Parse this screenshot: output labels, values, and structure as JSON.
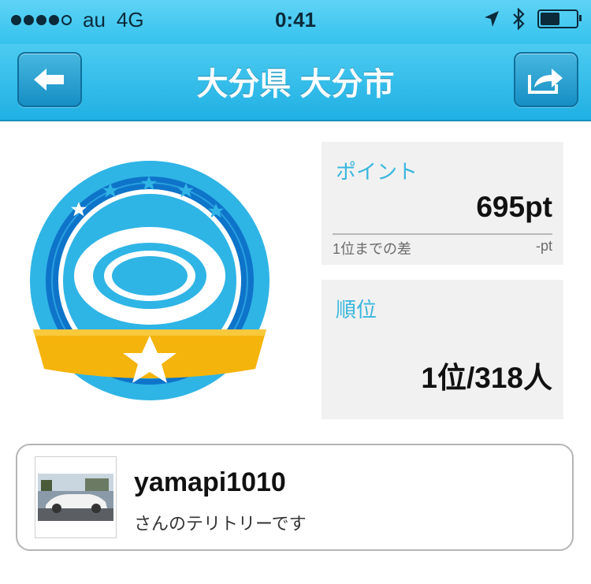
{
  "status_bar": {
    "carrier": "au",
    "network": "4G",
    "time": "0:41",
    "signal_bars_filled": 4,
    "signal_bars_total": 5,
    "battery_level": 0.55
  },
  "nav": {
    "title": "大分県 大分市",
    "back_icon": "back-arrow-icon",
    "share_icon": "share-icon"
  },
  "badge": {
    "icon": "territory-badge-icon",
    "colors": {
      "outer": "#2fb4e6",
      "ring": "#0e74c9",
      "ribbon": "#f5b40b",
      "star": "#ffffff"
    }
  },
  "points": {
    "label": "ポイント",
    "value": "695pt",
    "sub_label": "1位までの差",
    "sub_value": "-pt"
  },
  "rank": {
    "label": "順位",
    "value": "1位/318人"
  },
  "user": {
    "name": "yamapi1010",
    "subtitle": "さんのテリトリーです"
  },
  "colors": {
    "accent": "#39b6de",
    "nav_bg": "#20b0e3"
  }
}
